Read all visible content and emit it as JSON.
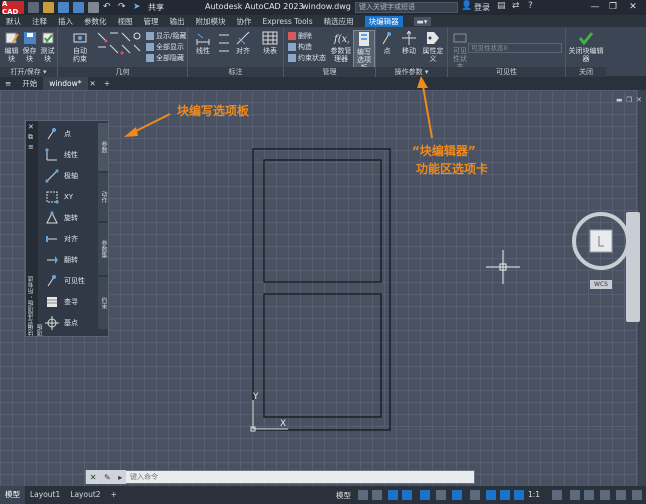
{
  "titlebar": {
    "logo_text": "A CAD",
    "share_label": "共享",
    "app_title": "Autodesk AutoCAD 2023",
    "file_title": "window.dwg",
    "search_placeholder": "键入关键字或短语",
    "login_label": "登录"
  },
  "ribbon_tabs": [
    "默认",
    "注释",
    "插入",
    "参数化",
    "视图",
    "管理",
    "输出",
    "附加模块",
    "协作",
    "Express Tools",
    "精选应用",
    "块编辑器"
  ],
  "ribbon": {
    "panels": {
      "open_save": {
        "title": "打开/保存 ▾",
        "tools": [
          "编辑块",
          "保存块",
          "测试块",
          "自动约束"
        ]
      },
      "geometry": {
        "title": "几何",
        "row_tools": [
          "显示/隐藏",
          "全部显示",
          "全部隐藏"
        ]
      },
      "dimension": {
        "title": "标注",
        "tools": [
          "线性",
          "对齐",
          "块表"
        ]
      },
      "manage": {
        "title": "管理",
        "row_tools": [
          "删除",
          "构造",
          "约束状态"
        ],
        "tools": [
          "参数管理器",
          "编写选项板"
        ]
      },
      "action_params": {
        "title": "操作参数 ▾",
        "tools": [
          "点",
          "移动",
          "属性定义"
        ]
      },
      "visibility": {
        "title": "可见性",
        "tools": [
          "可见性状态"
        ],
        "state_dropdown": "可见性状态0"
      },
      "close": {
        "title": "关闭",
        "tools": [
          "关闭块编辑器"
        ]
      }
    }
  },
  "file_tabs": [
    "开始",
    "window*",
    "+"
  ],
  "palette": {
    "vertical_title": "块编写选项板 - 所有选项板",
    "items": [
      "点",
      "线性",
      "极轴",
      "XY",
      "旋转",
      "对齐",
      "翻转",
      "可见性",
      "查寻",
      "基点"
    ],
    "side_tabs": [
      "参数",
      "动作",
      "参数集",
      "约束"
    ]
  },
  "annotations": {
    "palette_label": "块编写选项板",
    "ribbon_label_line1": "“块编辑器”",
    "ribbon_label_line2": "功能区选项卡"
  },
  "canvas": {
    "ucs_y": "Y",
    "ucs_x": "X",
    "wcs_label": "WCS"
  },
  "cmdline": {
    "placeholder": "键入命令"
  },
  "statusbar": {
    "layout_tabs": [
      "模型",
      "Layout1",
      "Layout2",
      "+"
    ],
    "model_label": "模型",
    "scale_label": "1:1"
  },
  "colors": {
    "accent": "#1a74c9",
    "annotation": "#f08a1c",
    "canvas_bg": "#4a5261",
    "ribbon_bg": "#3c4553"
  }
}
